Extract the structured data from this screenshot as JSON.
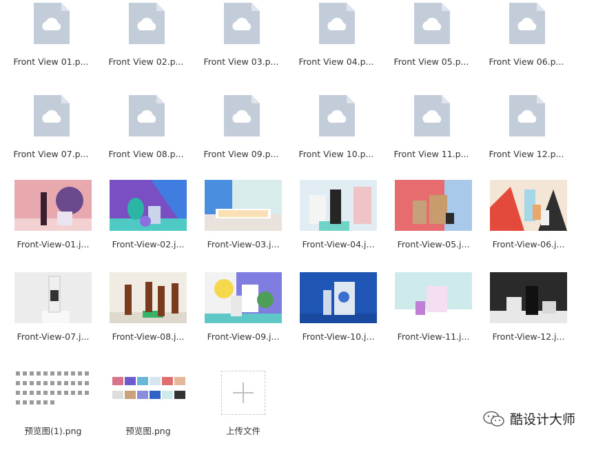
{
  "files": {
    "doc_rows": [
      [
        "Front View 01.p...",
        "Front View 02.p...",
        "Front View 03.p...",
        "Front View 04.p...",
        "Front View 05.p...",
        "Front View 06.p..."
      ],
      [
        "Front View 07.p...",
        "Front View 08.p...",
        "Front View 09.p...",
        "Front View 10.p...",
        "Front View 11.p...",
        "Front View 12.p..."
      ]
    ],
    "image_rows": [
      [
        "Front-View-01.j...",
        "Front-View-02.j...",
        "Front-View-03.j...",
        "Front-View-04.j...",
        "Front-View-05.j...",
        "Front-View-06.j..."
      ],
      [
        "Front-View-07.j...",
        "Front-View-08.j...",
        "Front-View-09.j...",
        "Front-View-10.j...",
        "Front-View-11.j...",
        "Front-View-12.j..."
      ]
    ],
    "previews": [
      "预览图(1).png",
      "预览图.png"
    ],
    "upload_label": "上传文件"
  },
  "watermark": {
    "text": "酷设计大师",
    "icon": "wechat-icon"
  },
  "colors": {
    "doc_icon": "#c3ccd9",
    "doc_fold": "#dfe4ec",
    "label": "#333333"
  }
}
